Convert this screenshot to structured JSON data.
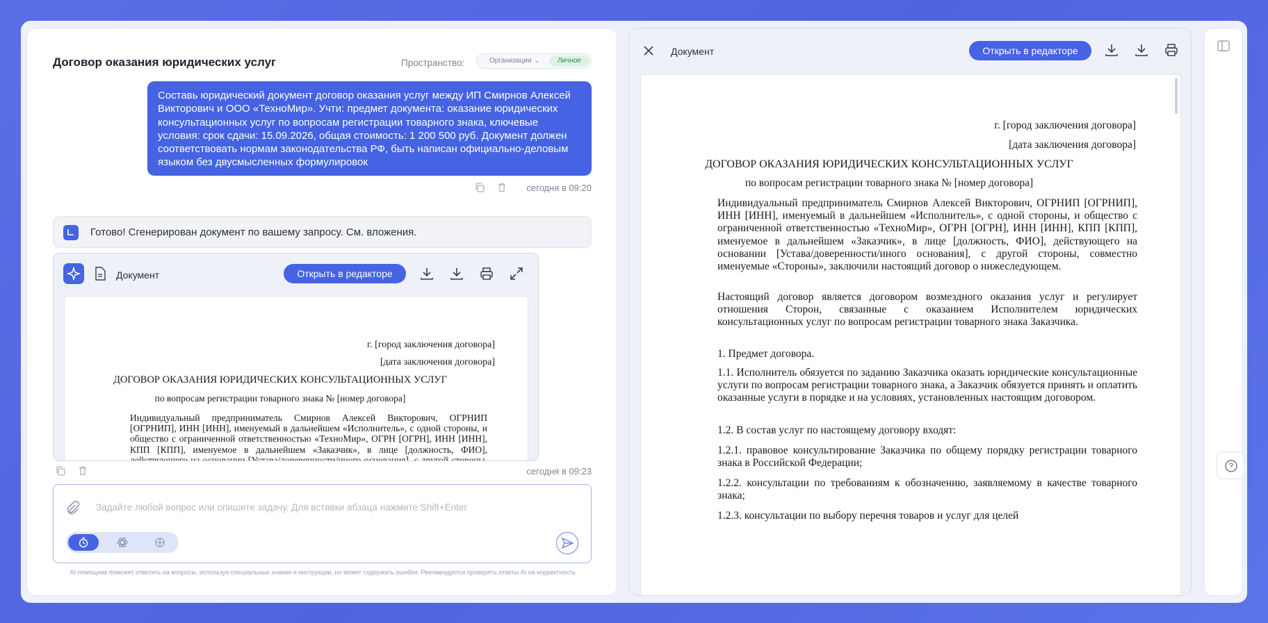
{
  "chat": {
    "title": "Договор оказания юридических услуг",
    "space_label": "Пространство:",
    "space_org": "Организации",
    "space_personal": "Личное",
    "user_message": "Составь юридический документ договор оказания услуг между ИП Смирнов Алексей Викторович и ООО «ТехноМир». Учти: предмет документа: оказание юридических консультационных услуг по вопросам регистрации товарного знака, ключевые условия: срок сдачи: 15.09.2026, общая стоимость: 1 200 500 руб. Документ должен соответствовать нормам законодательства РФ, быть написан официально-деловым языком без двусмысленных формулировок",
    "user_time": "сегодня в 09:20",
    "bot_message": "Готово! Сгенерирован документ по вашему запросу. См. вложения.",
    "bot_time": "сегодня в 09:23",
    "card": {
      "doc_label": "Документ",
      "open_editor": "Открыть в редакторе"
    },
    "input_placeholder": "Задайте любой вопрос или опишите задачу. Для вставки абзаца нажмите Shift+Enter",
    "disclaimer": "AI-помощник поможет ответить на вопросы, используя специальные знания и инструкции, но может содержать ошибки. Рекомендуется проверять ответы AI на корректность"
  },
  "panel": {
    "title": "Документ",
    "open_editor": "Открыть в редакторе"
  },
  "document": {
    "city": "г. [город заключения договора]",
    "date": "[дата заключения договора]",
    "heading": "ДОГОВОР ОКАЗАНИЯ ЮРИДИЧЕСКИХ КОНСУЛЬТАЦИОННЫХ УСЛУГ",
    "subheading": "по вопросам регистрации товарного знака № [номер договора]",
    "para1": "Индивидуальный предприниматель Смирнов Алексей Викторович, ОГРНИП [ОГРНИП], ИНН [ИНН], именуемый в дальнейшем «Исполнитель», с одной стороны, и общество с ограниченной ответственностью «ТехноМир», ОГРН [ОГРН], ИНН [ИНН], КПП [КПП], именуемое в дальнейшем «Заказчик», в лице [должность, ФИО], действующего на основании [Устава/доверенности/иного основания], с другой стороны, совместно именуемые «Стороны», заключили настоящий договор о нижеследующем.",
    "para2": "Настоящий договор является договором возмездного оказания услуг и регулирует отношения Сторон, связанные с оказанием Исполнителем юридических консультационных услуг по вопросам регистрации товарного знака Заказчика.",
    "section1": "1. Предмет договора.",
    "p1_1": "1.1. Исполнитель обязуется по заданию Заказчика оказать юридические консультационные услуги по вопросам регистрации товарного знака, а Заказчик обязуется принять и оплатить оказанные услуги в порядке и на условиях, установленных настоящим договором.",
    "p1_2": "1.2. В состав услуг по настоящему договору входят:",
    "p1_2_1": "1.2.1. правовое консультирование Заказчика по общему порядку регистрации товарного знака в Российской Федерации;",
    "p1_2_2": "1.2.2. консультации по требованиям к обозначению, заявляемому в качестве товарного знака;",
    "p1_2_3": "1.2.3. консультации по выбору перечня товаров и услуг для целей"
  },
  "colors": {
    "accent": "#4563e3",
    "background": "#5a6fe6",
    "personal_badge": "#def2e4"
  },
  "icons": {
    "copy": "copy-icon",
    "delete": "trash-icon",
    "download": "download-icon",
    "print": "print-icon",
    "expand": "expand-icon",
    "close": "close-icon",
    "attach": "paperclip-icon",
    "send": "send-icon",
    "sidebar": "sidebar-toggle-icon",
    "help": "chat-help-icon"
  }
}
